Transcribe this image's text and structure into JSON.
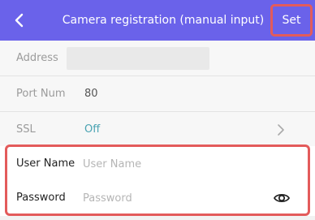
{
  "header": {
    "back_icon": "chevron-left-icon",
    "title": "Camera registration (manual input)",
    "set_label": "Set",
    "bg_color": "#6a62ea",
    "highlight_color": "#e35b5b"
  },
  "form": {
    "address": {
      "label": "Address",
      "value": ""
    },
    "port": {
      "label": "Port Num",
      "value": "80"
    },
    "ssl": {
      "label": "SSL",
      "value": "Off",
      "value_color": "#4aa3b2",
      "chevron_icon": "chevron-right-icon"
    },
    "username": {
      "label": "User Name",
      "value": "",
      "placeholder": "User Name"
    },
    "password": {
      "label": "Password",
      "value": "",
      "placeholder": "Password",
      "toggle_icon": "eye-icon"
    }
  }
}
